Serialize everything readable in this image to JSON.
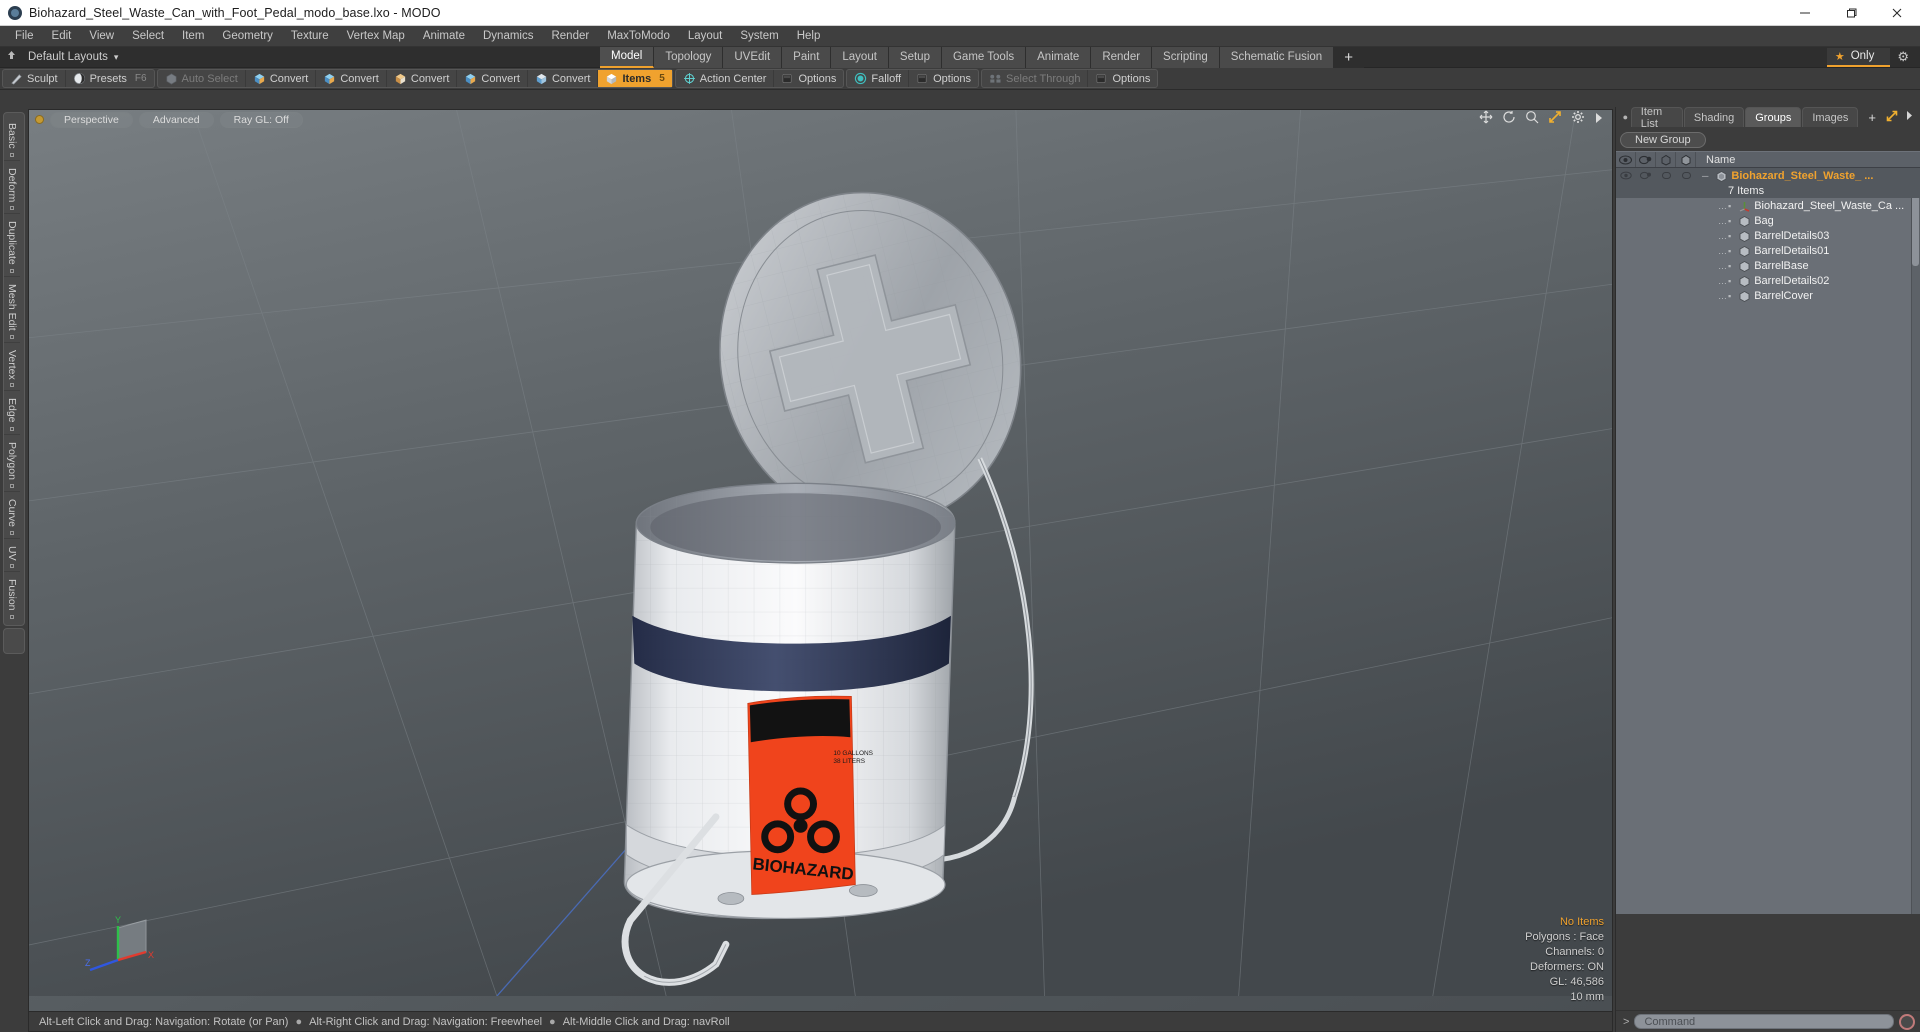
{
  "window": {
    "title": "Biohazard_Steel_Waste_Can_with_Foot_Pedal_modo_base.lxo - MODO",
    "minimize": "—",
    "maximize": "❐",
    "close": "✕"
  },
  "menubar": [
    "File",
    "Edit",
    "View",
    "Select",
    "Item",
    "Geometry",
    "Texture",
    "Vertex Map",
    "Animate",
    "Dynamics",
    "Render",
    "MaxToModo",
    "Layout",
    "System",
    "Help"
  ],
  "layout_row": {
    "layout_label": "Default Layouts",
    "layout_caret": "▾",
    "tabs": [
      {
        "label": "Model",
        "active": true
      },
      {
        "label": "Topology",
        "active": false
      },
      {
        "label": "UVEdit",
        "active": false
      },
      {
        "label": "Paint",
        "active": false
      },
      {
        "label": "Layout",
        "active": false
      },
      {
        "label": "Setup",
        "active": false
      },
      {
        "label": "Game Tools",
        "active": false
      },
      {
        "label": "Animate",
        "active": false
      },
      {
        "label": "Render",
        "active": false
      },
      {
        "label": "Scripting",
        "active": false
      },
      {
        "label": "Schematic Fusion",
        "active": false
      }
    ],
    "add_tab": "+",
    "only_label": "Only",
    "star_icon": "★",
    "gear_icon": "⚙"
  },
  "toolbar": {
    "groups": [
      {
        "buttons": [
          {
            "label": "Sculpt",
            "icon": "sculpt-icon",
            "key": "",
            "state": "normal"
          },
          {
            "label": "Presets",
            "icon": "presets-icon",
            "key": "F6",
            "state": "normal"
          }
        ]
      },
      {
        "buttons": [
          {
            "label": "Auto Select",
            "icon": "autoselect-icon",
            "key": "",
            "state": "dim"
          },
          {
            "label": "Convert",
            "icon": "convert-blue-icon",
            "key": "",
            "state": "normal"
          },
          {
            "label": "Convert",
            "icon": "convert-blue-icon",
            "key": "",
            "state": "normal"
          },
          {
            "label": "Convert",
            "icon": "convert-tan-icon",
            "key": "",
            "state": "normal"
          },
          {
            "label": "Convert",
            "icon": "convert-blue-icon",
            "key": "",
            "state": "normal"
          },
          {
            "label": "Convert",
            "icon": "convert-white-icon",
            "key": "",
            "state": "normal"
          },
          {
            "label": "Items",
            "icon": "items-icon",
            "key": "5",
            "state": "active"
          }
        ]
      },
      {
        "buttons": [
          {
            "label": "Action Center",
            "icon": "action-center-icon",
            "key": "",
            "state": "normal"
          },
          {
            "label": "Options",
            "icon": "options-icon",
            "key": "",
            "state": "normal"
          }
        ]
      },
      {
        "buttons": [
          {
            "label": "Falloff",
            "icon": "falloff-icon",
            "key": "",
            "state": "normal"
          },
          {
            "label": "Options",
            "icon": "options-icon",
            "key": "",
            "state": "normal"
          }
        ]
      },
      {
        "buttons": [
          {
            "label": "Select Through",
            "icon": "select-through-icon",
            "key": "",
            "state": "dim"
          },
          {
            "label": "Options",
            "icon": "options-icon",
            "key": "",
            "state": "normal"
          }
        ]
      }
    ]
  },
  "left_rail": {
    "tabs": [
      "Basic",
      "Deform",
      "Duplicate",
      "Mesh Edit",
      "Vertex",
      "Edge",
      "Polygon",
      "Curve",
      "UV",
      "Fusion"
    ]
  },
  "viewport": {
    "pills": [
      "Perspective",
      "Advanced",
      "Ray GL: Off"
    ],
    "icons": [
      "move-icon",
      "rotate-icon",
      "zoom-icon",
      "fit-icon",
      "gear-icon",
      "chevron-right-icon"
    ],
    "stats": {
      "selection": "No Items",
      "polygons": "Polygons : Face",
      "channels": "Channels: 0",
      "deformers": "Deformers: ON",
      "gl": "GL: 46,586",
      "grid": "10 mm"
    },
    "axes": {
      "x": "X",
      "y": "Y",
      "z": "Z"
    },
    "status": [
      "Alt-Left Click and Drag: Navigation: Rotate (or Pan)",
      "Alt-Right Click and Drag: Navigation: Freewheel",
      "Alt-Middle Click and Drag: navRoll"
    ],
    "bullet": "●",
    "model_label": "BIOHAZARD",
    "label_sub1": "10 GALLONS",
    "label_sub2": "38 LITERS"
  },
  "right_panel": {
    "tabs": [
      {
        "label": "Item List",
        "active": false
      },
      {
        "label": "Shading",
        "active": false
      },
      {
        "label": "Groups",
        "active": true
      },
      {
        "label": "Images",
        "active": false
      }
    ],
    "add_tab": "+",
    "tab_icons": [
      "expand-icon",
      "chevron-right-icon"
    ],
    "new_group_label": "New Group",
    "tree_headers": {
      "visible": "eye-icon",
      "render": "render-icon",
      "lock": "lock-icon",
      "wire": "wire-icon",
      "name": "Name"
    },
    "tree": [
      {
        "name": "Biohazard_Steel_Waste_ ...",
        "icon": "group-icon",
        "level": 0,
        "selected": true,
        "gold": true,
        "count": "7 Items"
      },
      {
        "name": "Biohazard_Steel_Waste_Ca ...",
        "icon": "locator-icon",
        "level": 1,
        "selected": false,
        "gold": false
      },
      {
        "name": "Bag",
        "icon": "mesh-icon",
        "level": 1,
        "selected": false,
        "gold": false
      },
      {
        "name": "BarrelDetails03",
        "icon": "mesh-icon",
        "level": 1,
        "selected": false,
        "gold": false
      },
      {
        "name": "BarrelDetails01",
        "icon": "mesh-icon",
        "level": 1,
        "selected": false,
        "gold": false
      },
      {
        "name": "BarrelBase",
        "icon": "mesh-icon",
        "level": 1,
        "selected": false,
        "gold": false
      },
      {
        "name": "BarrelDetails02",
        "icon": "mesh-icon",
        "level": 1,
        "selected": false,
        "gold": false
      },
      {
        "name": "BarrelCover",
        "icon": "mesh-icon",
        "level": 1,
        "selected": false,
        "gold": false
      }
    ],
    "command": {
      "caret": ">",
      "placeholder": "Command",
      "record_icon": "record-icon"
    }
  },
  "colors": {
    "accent": "#f0a22e",
    "panel": "#3c3c3c",
    "tree_bg": "#6a6f76",
    "biohazard_orange": "#f0441c"
  }
}
